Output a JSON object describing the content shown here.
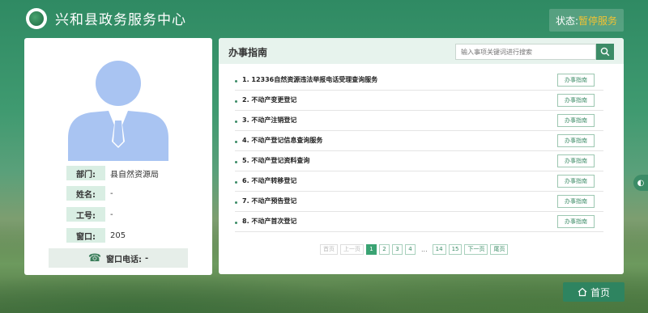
{
  "header": {
    "site_title": "兴和县政务服务中心",
    "status_label": "状态:",
    "status_value": "暂停服务"
  },
  "profile": {
    "department_label": "部门:",
    "department_value": "县自然资源局",
    "name_label": "姓名:",
    "name_value": "-",
    "employee_id_label": "工号:",
    "employee_id_value": "-",
    "window_label": "窗口:",
    "window_value": "205",
    "phone_label": "窗口电话:",
    "phone_value": "-"
  },
  "guide": {
    "title": "办事指南",
    "search_placeholder": "输入事项关键词进行搜索",
    "button_label": "办事指南",
    "items": [
      "1. 12336自然资源违法举报电话受理查询服务",
      "2. 不动产变更登记",
      "3. 不动产注销登记",
      "4. 不动产登记信息查询服务",
      "5. 不动产登记资料查询",
      "6. 不动产转移登记",
      "7. 不动产预告登记",
      "8. 不动产首次登记"
    ]
  },
  "pagination": {
    "first": "首页",
    "prev": "上一页",
    "pages": [
      "1",
      "2",
      "3",
      "4"
    ],
    "ellipsis": "...",
    "tail_pages": [
      "14",
      "15"
    ],
    "next": "下一页",
    "last": "尾页",
    "current": "1"
  },
  "footer": {
    "home_label": "首页"
  },
  "icons": {
    "phone": "phone-icon",
    "search": "search-icon",
    "home": "home-icon",
    "logo": "logo-icon",
    "side": "side-tab-icon"
  },
  "colors": {
    "accent": "#3c8c67",
    "status": "#f1c232",
    "avatar": "#a9c4f2"
  }
}
